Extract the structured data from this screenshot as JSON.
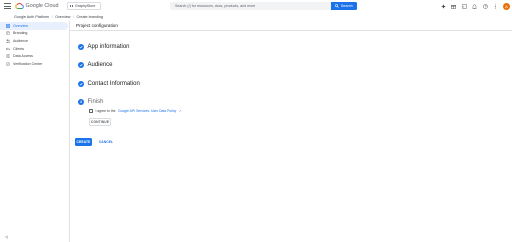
{
  "topbar": {
    "brand": "Google Cloud",
    "project": "GraphyStore",
    "search_placeholder": "Search (/) for resources, docs, products, and more",
    "search_button": "Search",
    "avatar_initial": "A"
  },
  "breadcrumb": {
    "items": [
      "Google Auth Platform",
      "Overview",
      "Create branding"
    ]
  },
  "sidebar": {
    "items": [
      {
        "label": "Overview",
        "icon": "grid-icon",
        "active": true
      },
      {
        "label": "Branding",
        "icon": "palette-icon",
        "active": false
      },
      {
        "label": "Audience",
        "icon": "people-icon",
        "active": false
      },
      {
        "label": "Clients",
        "icon": "key-icon",
        "active": false
      },
      {
        "label": "Data Access",
        "icon": "tune-icon",
        "active": false
      },
      {
        "label": "Verification Center",
        "icon": "verified-icon",
        "active": false
      }
    ],
    "collapse": "<|"
  },
  "main": {
    "title": "Project configuration",
    "steps": [
      {
        "label": "App information",
        "state": "done"
      },
      {
        "label": "Audience",
        "state": "done"
      },
      {
        "label": "Contact Information",
        "state": "done"
      },
      {
        "label": "Finish",
        "state": "current",
        "number": "4"
      }
    ],
    "agree_prefix": "I agree to the",
    "agree_link": "Google API Services: User Data Policy",
    "continue_label": "CONTINUE",
    "create_label": "CREATE",
    "cancel_label": "CANCEL"
  },
  "colors": {
    "accent": "#1a73e8",
    "avatar": "#e8710a",
    "active_bg": "#e8f0fe"
  }
}
